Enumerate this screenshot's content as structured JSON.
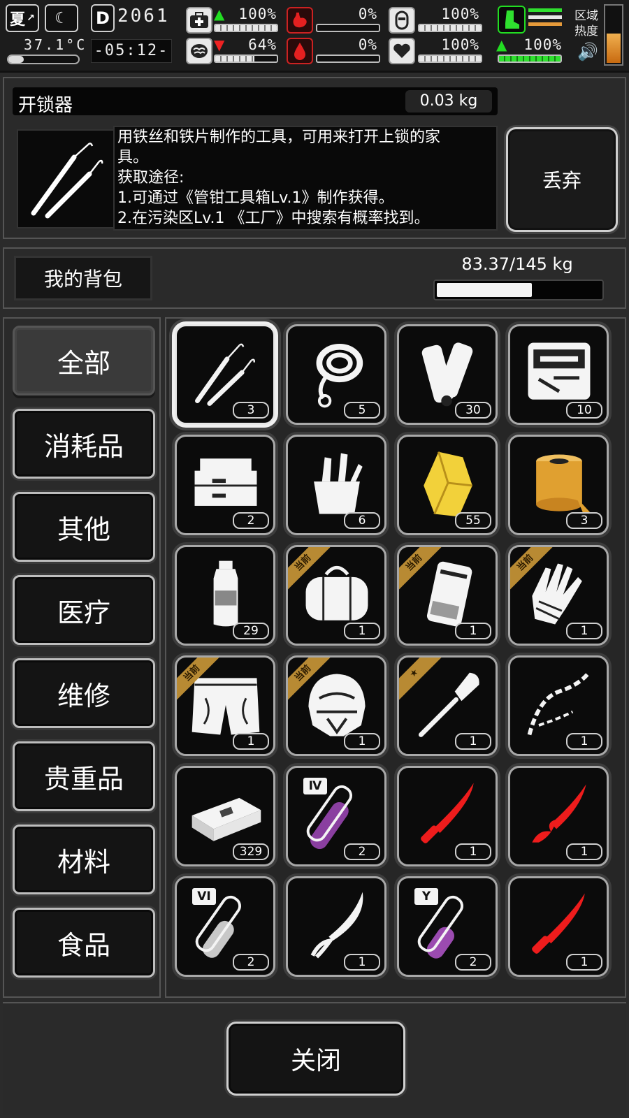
{
  "status": {
    "season": "夏",
    "temperature": "37.1°C",
    "day": "2061",
    "time": "-05:12-",
    "stats": [
      {
        "name": "health",
        "value": "100%",
        "fill": 1.0,
        "trend": "up"
      },
      {
        "name": "stomach",
        "value": "0%",
        "fill": 0.0,
        "trend": ""
      },
      {
        "name": "stamina",
        "value": "100%",
        "fill": 1.0,
        "trend": ""
      },
      {
        "name": "sanity",
        "value": "64%",
        "fill": 0.64,
        "trend": "down"
      },
      {
        "name": "thirst",
        "value": "0%",
        "fill": 0.0,
        "trend": ""
      },
      {
        "name": "mood",
        "value": "100%",
        "fill": 1.0,
        "trend": ""
      },
      {
        "name": "move",
        "value": "100%",
        "fill": 1.0,
        "trend": "up"
      }
    ],
    "zone_heat_label": [
      "区域",
      "热度"
    ],
    "colors": {
      "green": "#22dd22",
      "red": "#ee2222",
      "heat": "#e59a3a"
    }
  },
  "detail": {
    "name": "开锁器",
    "weight": "0.03 kg",
    "description": [
      "用铁丝和铁片制作的工具，可用来打开上锁的家",
      "具。",
      "获取途径:",
      "1.可通过《管钳工具箱Lv.1》制作获得。",
      "2.在污染区Lv.1 《工厂》中搜索有概率找到。"
    ],
    "discard_label": "丢弃"
  },
  "bag": {
    "title": "我的背包",
    "weight_text": "83.37/145 kg",
    "fill": 0.575
  },
  "categories": [
    {
      "label": "全部",
      "active": true
    },
    {
      "label": "消耗品",
      "active": false
    },
    {
      "label": "其他",
      "active": false
    },
    {
      "label": "医疗",
      "active": false
    },
    {
      "label": "维修",
      "active": false
    },
    {
      "label": "贵重品",
      "active": false
    },
    {
      "label": "材料",
      "active": false
    },
    {
      "label": "食品",
      "active": false
    }
  ],
  "items": [
    {
      "icon": "lockpick-icon",
      "count": "3",
      "badge": "",
      "selected": true
    },
    {
      "icon": "rope-icon",
      "count": "5",
      "badge": ""
    },
    {
      "icon": "paper-roll-icon",
      "count": "30",
      "badge": ""
    },
    {
      "icon": "toolkit-case-icon",
      "count": "10",
      "badge": ""
    },
    {
      "icon": "toolbox-icon",
      "count": "2",
      "badge": ""
    },
    {
      "icon": "tool-bag-icon",
      "count": "6",
      "badge": ""
    },
    {
      "icon": "crystal-icon",
      "count": "55",
      "badge": ""
    },
    {
      "icon": "tape-roll-icon",
      "count": "3",
      "badge": ""
    },
    {
      "icon": "water-bottle-icon",
      "count": "29",
      "badge": ""
    },
    {
      "icon": "duffel-bag-icon",
      "count": "1",
      "badge": "当前"
    },
    {
      "icon": "backpack-icon",
      "count": "1",
      "badge": "当前"
    },
    {
      "icon": "gloves-icon",
      "count": "1",
      "badge": "当前"
    },
    {
      "icon": "shorts-icon",
      "count": "1",
      "badge": "当前"
    },
    {
      "icon": "helmet-icon",
      "count": "1",
      "badge": "当前"
    },
    {
      "icon": "shovel-icon",
      "count": "1",
      "badge": "star"
    },
    {
      "icon": "chain-icon",
      "count": "1",
      "badge": ""
    },
    {
      "icon": "cash-bundle-icon",
      "count": "329",
      "badge": ""
    },
    {
      "icon": "potion-IV-icon",
      "count": "2",
      "badge": "",
      "tag": "Ⅳ"
    },
    {
      "icon": "red-knife-icon",
      "count": "1",
      "badge": ""
    },
    {
      "icon": "red-serpent-dagger-icon",
      "count": "1",
      "badge": ""
    },
    {
      "icon": "potion-VI-icon",
      "count": "2",
      "badge": "",
      "tag": "VI"
    },
    {
      "icon": "curved-dagger-icon",
      "count": "1",
      "badge": ""
    },
    {
      "icon": "potion-Y-icon",
      "count": "2",
      "badge": "",
      "tag": "Y"
    },
    {
      "icon": "red-knife-icon",
      "count": "1",
      "badge": ""
    }
  ],
  "close_label": "关闭"
}
